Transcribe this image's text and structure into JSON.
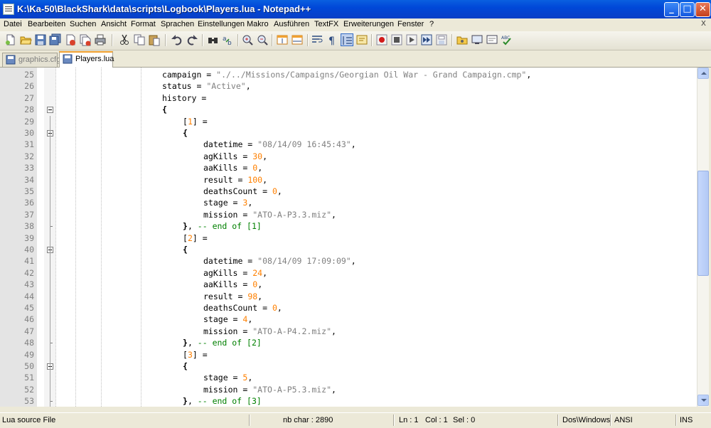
{
  "window": {
    "title": "K:\\Ka-50\\BlackShark\\data\\scripts\\Logbook\\Players.lua - Notepad++",
    "minimize_label": "_",
    "maximize_label": "□",
    "close_label": "✕"
  },
  "menu": {
    "items": [
      "Datei",
      "Bearbeiten",
      "Suchen",
      "Ansicht",
      "Format",
      "Sprachen",
      "Einstellungen",
      "Makro",
      "Ausführen",
      "TextFX",
      "Erweiterungen",
      "Fenster",
      "?"
    ],
    "close_doc_label": "X"
  },
  "toolbar": {
    "icons": [
      "new-file-icon",
      "open-file-icon",
      "save-icon",
      "save-all-icon",
      "close-icon",
      "close-all-icon",
      "print-icon",
      "cut-icon",
      "copy-icon",
      "paste-icon",
      "undo-icon",
      "redo-icon",
      "find-icon",
      "replace-icon",
      "zoom-in-icon",
      "zoom-out-icon",
      "sync-v-icon",
      "sync-h-icon",
      "wrap-icon",
      "show-all-chars-icon",
      "indent-guide-icon",
      "user-lang-icon",
      "record-macro-icon",
      "stop-record-icon",
      "play-macro-icon",
      "play-multiple-icon",
      "save-macro-icon",
      "tail-icon",
      "monitor-icon",
      "preview-icon",
      "spellcheck-icon"
    ]
  },
  "tabs": [
    {
      "label": "graphics.cfg",
      "active": false
    },
    {
      "label": "Players.lua",
      "active": true
    }
  ],
  "editor": {
    "lines": [
      {
        "n": "25",
        "indent": 0,
        "parts": [
          [
            "t",
            "campaign = "
          ],
          [
            "s",
            "\"./../Missions/Campaigns/Georgian Oil War - Grand Campaign.cmp\""
          ],
          [
            "t",
            ","
          ]
        ]
      },
      {
        "n": "26",
        "indent": 0,
        "parts": [
          [
            "t",
            "status = "
          ],
          [
            "s",
            "\"Active\""
          ],
          [
            "t",
            ","
          ]
        ]
      },
      {
        "n": "27",
        "indent": 0,
        "parts": [
          [
            "t",
            "history ="
          ]
        ]
      },
      {
        "n": "28",
        "indent": 0,
        "fold": "open",
        "parts": [
          [
            "b",
            "{"
          ]
        ]
      },
      {
        "n": "29",
        "indent": 1,
        "parts": [
          [
            "t",
            "["
          ],
          [
            "n",
            "1"
          ],
          [
            "t",
            "] ="
          ]
        ]
      },
      {
        "n": "30",
        "indent": 1,
        "fold": "open",
        "parts": [
          [
            "b",
            "{"
          ]
        ]
      },
      {
        "n": "31",
        "indent": 2,
        "parts": [
          [
            "t",
            "datetime = "
          ],
          [
            "s",
            "\"08/14/09 16:45:43\""
          ],
          [
            "t",
            ","
          ]
        ]
      },
      {
        "n": "32",
        "indent": 2,
        "parts": [
          [
            "t",
            "agKills = "
          ],
          [
            "n",
            "30"
          ],
          [
            "t",
            ","
          ]
        ]
      },
      {
        "n": "33",
        "indent": 2,
        "parts": [
          [
            "t",
            "aaKills = "
          ],
          [
            "n",
            "0"
          ],
          [
            "t",
            ","
          ]
        ]
      },
      {
        "n": "34",
        "indent": 2,
        "parts": [
          [
            "t",
            "result = "
          ],
          [
            "n",
            "100"
          ],
          [
            "t",
            ","
          ]
        ]
      },
      {
        "n": "35",
        "indent": 2,
        "parts": [
          [
            "t",
            "deathsCount = "
          ],
          [
            "n",
            "0"
          ],
          [
            "t",
            ","
          ]
        ]
      },
      {
        "n": "36",
        "indent": 2,
        "parts": [
          [
            "t",
            "stage = "
          ],
          [
            "n",
            "3"
          ],
          [
            "t",
            ","
          ]
        ]
      },
      {
        "n": "37",
        "indent": 2,
        "parts": [
          [
            "t",
            "mission = "
          ],
          [
            "s",
            "\"ATO-A-P3.3.miz\""
          ],
          [
            "t",
            ","
          ]
        ]
      },
      {
        "n": "38",
        "indent": 1,
        "fold": "end",
        "parts": [
          [
            "b",
            "}"
          ],
          [
            "t",
            ", "
          ],
          [
            "c",
            "-- end of [1]"
          ]
        ]
      },
      {
        "n": "39",
        "indent": 1,
        "parts": [
          [
            "t",
            "["
          ],
          [
            "n",
            "2"
          ],
          [
            "t",
            "] ="
          ]
        ]
      },
      {
        "n": "40",
        "indent": 1,
        "fold": "open",
        "parts": [
          [
            "b",
            "{"
          ]
        ]
      },
      {
        "n": "41",
        "indent": 2,
        "parts": [
          [
            "t",
            "datetime = "
          ],
          [
            "s",
            "\"08/14/09 17:09:09\""
          ],
          [
            "t",
            ","
          ]
        ]
      },
      {
        "n": "42",
        "indent": 2,
        "parts": [
          [
            "t",
            "agKills = "
          ],
          [
            "n",
            "24"
          ],
          [
            "t",
            ","
          ]
        ]
      },
      {
        "n": "43",
        "indent": 2,
        "parts": [
          [
            "t",
            "aaKills = "
          ],
          [
            "n",
            "0"
          ],
          [
            "t",
            ","
          ]
        ]
      },
      {
        "n": "44",
        "indent": 2,
        "parts": [
          [
            "t",
            "result = "
          ],
          [
            "n",
            "98"
          ],
          [
            "t",
            ","
          ]
        ]
      },
      {
        "n": "45",
        "indent": 2,
        "parts": [
          [
            "t",
            "deathsCount = "
          ],
          [
            "n",
            "0"
          ],
          [
            "t",
            ","
          ]
        ]
      },
      {
        "n": "46",
        "indent": 2,
        "parts": [
          [
            "t",
            "stage = "
          ],
          [
            "n",
            "4"
          ],
          [
            "t",
            ","
          ]
        ]
      },
      {
        "n": "47",
        "indent": 2,
        "parts": [
          [
            "t",
            "mission = "
          ],
          [
            "s",
            "\"ATO-A-P4.2.miz\""
          ],
          [
            "t",
            ","
          ]
        ]
      },
      {
        "n": "48",
        "indent": 1,
        "fold": "end",
        "parts": [
          [
            "b",
            "}"
          ],
          [
            "t",
            ", "
          ],
          [
            "c",
            "-- end of [2]"
          ]
        ]
      },
      {
        "n": "49",
        "indent": 1,
        "parts": [
          [
            "t",
            "["
          ],
          [
            "n",
            "3"
          ],
          [
            "t",
            "] ="
          ]
        ]
      },
      {
        "n": "50",
        "indent": 1,
        "fold": "open",
        "parts": [
          [
            "b",
            "{"
          ]
        ]
      },
      {
        "n": "51",
        "indent": 2,
        "parts": [
          [
            "t",
            "stage = "
          ],
          [
            "n",
            "5"
          ],
          [
            "t",
            ","
          ]
        ]
      },
      {
        "n": "52",
        "indent": 2,
        "parts": [
          [
            "t",
            "mission = "
          ],
          [
            "s",
            "\"ATO-A-P5.3.miz\""
          ],
          [
            "t",
            ","
          ]
        ]
      },
      {
        "n": "53",
        "indent": 1,
        "fold": "end",
        "parts": [
          [
            "b",
            "}"
          ],
          [
            "t",
            ", "
          ],
          [
            "c",
            "-- end of [3]"
          ]
        ]
      }
    ]
  },
  "status": {
    "filetype": "Lua source File",
    "nb_char": "nb char : 2890",
    "ln": "Ln : 1",
    "col": "Col : 1",
    "sel": "Sel : 0",
    "eol": "Dos\\Windows",
    "encoding": "ANSI",
    "mode": "INS"
  },
  "colors": {
    "title_bar": "#0054e3",
    "string": "#808080",
    "number": "#ff8000",
    "comment": "#008000",
    "active_tab_accent": "#f0a030"
  }
}
